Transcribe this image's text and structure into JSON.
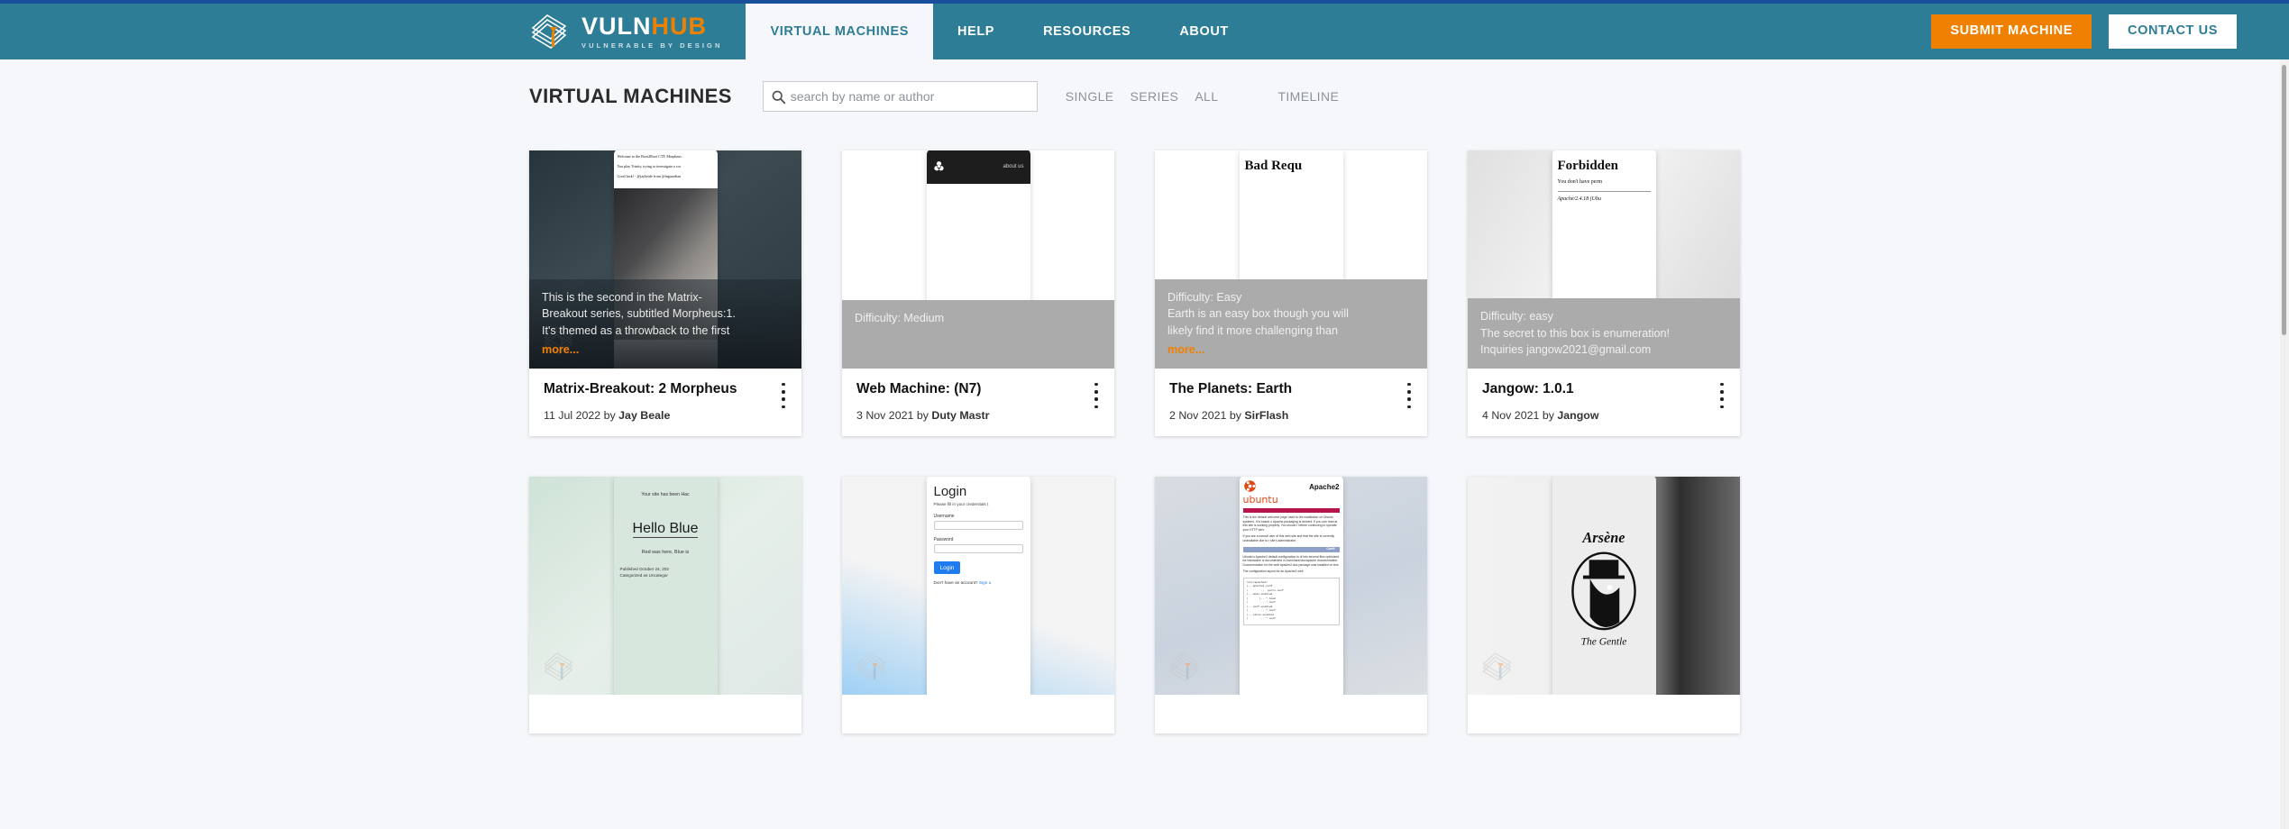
{
  "brand": {
    "word1": "VULN",
    "word2": "HUB",
    "tagline": "VULNERABLE BY DESIGN",
    "logo_icon": "vulnhub-stack-logo-icon"
  },
  "colors": {
    "navbar": "#2e7d96",
    "navbar_top_border": "#1a4f9c",
    "accent_orange": "#f08000",
    "page_background": "#f5f7fa",
    "difficulty_overlay_grey": "#ababab"
  },
  "nav": {
    "links": [
      {
        "label": "VIRTUAL MACHINES",
        "active": true
      },
      {
        "label": "HELP",
        "active": false
      },
      {
        "label": "RESOURCES",
        "active": false
      },
      {
        "label": "ABOUT",
        "active": false
      }
    ],
    "submit_label": "SUBMIT MACHINE",
    "contact_label": "CONTACT US"
  },
  "header": {
    "title": "VIRTUAL MACHINES",
    "search": {
      "placeholder": "search by name or author",
      "value": "",
      "icon": "search-icon"
    },
    "filters": [
      {
        "label": "SINGLE",
        "spaced": false
      },
      {
        "label": "SERIES",
        "spaced": false
      },
      {
        "label": "ALL",
        "spaced": false
      },
      {
        "label": "TIMELINE",
        "spaced": true
      }
    ]
  },
  "cards": [
    {
      "title": "Matrix-Breakout: 2 Morpheus",
      "date": "11 Jul 2022",
      "by_label": "by",
      "author": "Jay Beale",
      "overlay_style": "dark",
      "overlay_lines": [
        "This is the second in the Matrix-",
        "Breakout series, subtitled Morpheus:1.",
        "It's themed as a throwback to the first"
      ],
      "more_label": "more...",
      "preview_type": "matrix",
      "preview": {
        "line1": "Welcome to the Boot2Root CTF, Morpheus",
        "line2": "You play Trinity, trying to investigate a cor",
        "line3": "Good luck! - @jaybeale from @inguardian"
      },
      "menu_icon": "kebab-menu-icon"
    },
    {
      "title": "Web Machine: (N7)",
      "date": "3 Nov 2021",
      "by_label": "by",
      "author": "Duty Mastr",
      "overlay_style": "grey",
      "overlay_lines": [
        "Difficulty: Medium"
      ],
      "more_label": "",
      "preview_type": "n7",
      "preview": {
        "nav_label": "about us",
        "logo_icon": "biohazard-icon"
      },
      "menu_icon": "kebab-menu-icon"
    },
    {
      "title": "The Planets: Earth",
      "date": "2 Nov 2021",
      "by_label": "by",
      "author": "SirFlash",
      "overlay_style": "grey",
      "overlay_lines": [
        "Difficulty: Easy",
        "Earth is an easy box though you will",
        "likely find it more challenging than"
      ],
      "more_label": "more...",
      "preview_type": "badrequest",
      "preview": {
        "heading": "Bad Requ"
      },
      "menu_icon": "kebab-menu-icon"
    },
    {
      "title": "Jangow: 1.0.1",
      "date": "4 Nov 2021",
      "by_label": "by",
      "author": "Jangow",
      "overlay_style": "grey",
      "overlay_lines": [
        "Difficulty: easy",
        "The secret to this box is enumeration!",
        "Inquiries jangow2021@gmail.com"
      ],
      "more_label": "",
      "preview_type": "forbidden",
      "preview": {
        "heading": "Forbidden",
        "body": "You don't have perm",
        "footer": "Apache/2.4.18 (Ubu"
      },
      "menu_icon": "kebab-menu-icon"
    },
    {
      "title": "",
      "date": "",
      "by_label": "",
      "author": "",
      "overlay_style": "none",
      "overlay_lines": [],
      "more_label": "",
      "preview_type": "hellobluee",
      "preview": {
        "hacked": "Your site has been Hac",
        "heading": "Hello Blue",
        "body": "Red was here, Blue is",
        "published": "Published October 24, 202",
        "category": "Categorized as Uncategor"
      },
      "menu_icon": "kebab-menu-icon"
    },
    {
      "title": "",
      "date": "",
      "by_label": "",
      "author": "",
      "overlay_style": "none",
      "overlay_lines": [],
      "more_label": "",
      "preview_type": "login",
      "preview": {
        "heading": "Login",
        "subtitle": "Please fill in your credentials t",
        "username_label": "Username",
        "password_label": "Password",
        "button": "Login",
        "footer": "Don't have an account?",
        "footer_link": "Sign u"
      },
      "menu_icon": "kebab-menu-icon"
    },
    {
      "title": "",
      "date": "",
      "by_label": "",
      "author": "",
      "overlay_style": "none",
      "overlay_lines": [],
      "more_label": "",
      "preview_type": "apache",
      "preview": {
        "ubuntu": "ubuntu",
        "apache": "Apache2",
        "p1": "This is the default welcome page used to tes installation on Ubuntu systems. It is based o Apache packaging is derived. If you can read at this site is working properly. You should r before continuing to operate your HTTP serv",
        "p2": "If you are a normal user of this web site and that the site is currently unavailable due to r site's administrator.",
        "section": "Confi",
        "p3": "Ubuntu's Apache2 default configuration is di into several files optimized for interaction w documented in /usr/share/doc/apache documentation. Documentation for the web apache2-doc package was installed on this",
        "p4": "The configuration layout for an Apache2 web",
        "tree": "/etc/apache2/\n|-- apache2.conf\n|       `--  ports.conf\n|-- mods-enabled\n|       |-- *.load\n|       `-- *.conf\n|-- conf-enabled\n|       `-- *.conf\n|-- sites-enabled\n|       `-- *.conf"
      },
      "menu_icon": "kebab-menu-icon"
    },
    {
      "title": "",
      "date": "",
      "by_label": "",
      "author": "",
      "overlay_style": "none",
      "overlay_lines": [],
      "more_label": "",
      "preview_type": "arsene",
      "preview": {
        "top": "Arsène",
        "bottom": "The Gentle"
      },
      "menu_icon": "kebab-menu-icon"
    }
  ]
}
